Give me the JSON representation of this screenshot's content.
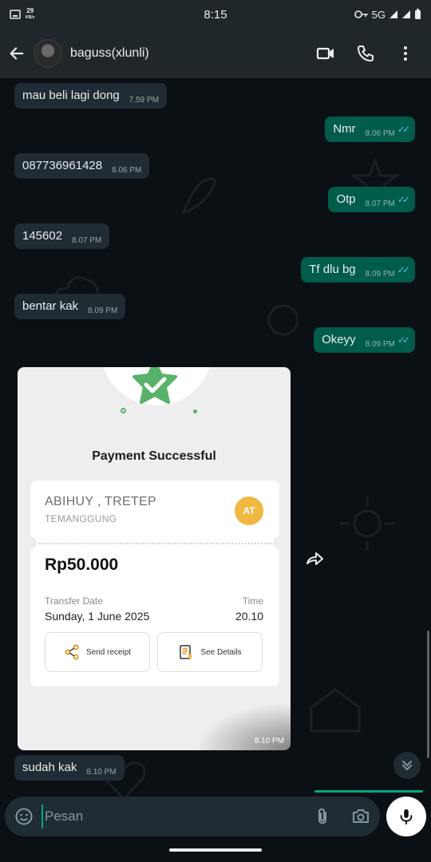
{
  "status_bar": {
    "time": "8:15",
    "left_small": "29",
    "left_small2": "KB/s",
    "network": "5G"
  },
  "header": {
    "contact_name": "baguss(xlunli)"
  },
  "messages": [
    {
      "text": "mau beli lagi dong",
      "time": "7.59 PM"
    },
    {
      "text": "Nmr",
      "time": "8.06 PM"
    },
    {
      "text": "087736961428",
      "time": "8.06 PM"
    },
    {
      "text": "Otp",
      "time": "8.07 PM"
    },
    {
      "text": "145602",
      "time": "8.07 PM"
    },
    {
      "text": "Tf dlu bg",
      "time": "8.09 PM"
    },
    {
      "text": "bentar kak",
      "time": "8.09 PM"
    },
    {
      "text": "Okeyy",
      "time": "8.09 PM"
    },
    {
      "text": "sudah kak",
      "time": "8.10 PM"
    }
  ],
  "receipt": {
    "title": "Payment Successful",
    "payee": "ABIHUY , TRETEP",
    "city": "TEMANGGUNG",
    "initials": "AT",
    "amount": "Rp50.000",
    "date_label": "Transfer Date",
    "date_value": "Sunday, 1 June 2025",
    "time_label": "Time",
    "time_value": "20.10",
    "send_receipt": "Send receipt",
    "see_details": "See Details",
    "sent_time": "8.10 PM"
  },
  "input": {
    "placeholder": "Pesan"
  },
  "colors": {
    "incoming": "#1f2c33",
    "outgoing": "#005c4b",
    "ticks": "#53bdeb",
    "accent": "#00a884",
    "initials_bg": "#f1b841",
    "star": "#58b26a"
  },
  "icons": [
    "back-arrow-icon",
    "video-call-icon",
    "phone-icon",
    "more-vert-icon",
    "forward-icon",
    "chevron-double-down-icon",
    "emoji-icon",
    "attach-icon",
    "camera-icon",
    "mic-icon",
    "share-icon",
    "document-icon",
    "star-check-icon"
  ]
}
